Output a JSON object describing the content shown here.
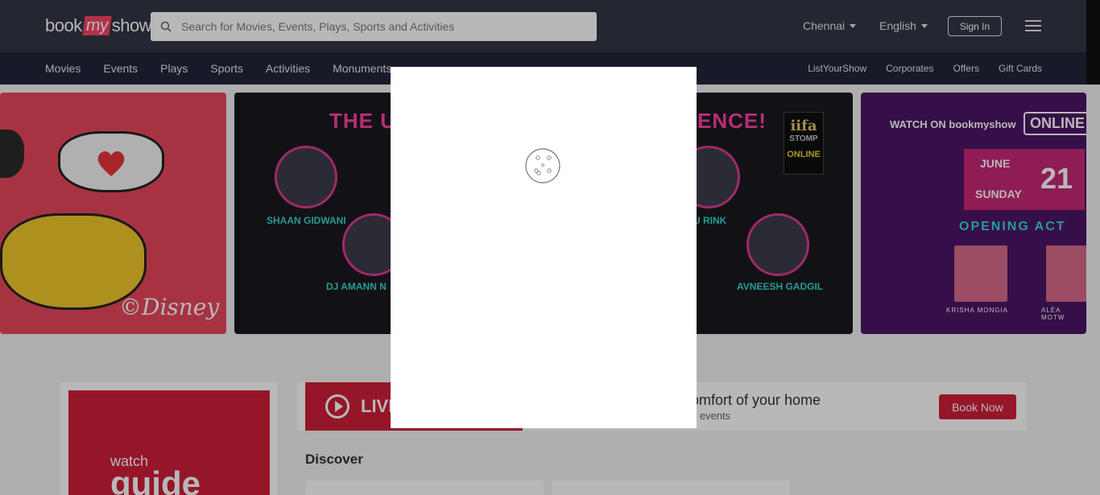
{
  "header": {
    "logo": {
      "book": "book",
      "my": "my",
      "show": "show"
    },
    "search": {
      "placeholder": "Search for Movies, Events, Plays, Sports and Activities"
    },
    "city": "Chennai",
    "language": "English",
    "sign_in": "Sign In"
  },
  "nav": {
    "left": [
      "Movies",
      "Events",
      "Plays",
      "Sports",
      "Activities",
      "Monuments"
    ],
    "right": [
      "ListYourShow",
      "Corporates",
      "Offers",
      "Gift Cards"
    ]
  },
  "banners": {
    "disney": {
      "text": "©Disney"
    },
    "iifa": {
      "title_left": "THE U",
      "title_right": "ENCE!",
      "logo_line1": "iifa",
      "logo_line2": "STOMP",
      "logo_line3": "ONLINE",
      "names": [
        "SHAAN GIDWANI",
        "DJ AMANN N",
        "U RINK",
        "AVNEESH GADGIL"
      ]
    },
    "watch_online": {
      "watch_on": "WATCH ON bookmyshow",
      "online": "ONLINE",
      "month": "JUNE",
      "day": "SUNDAY",
      "date": "21",
      "opening": "OPENING ACT",
      "names": [
        "KRISHA MONGIA",
        "ALÈA MOTW"
      ]
    }
  },
  "lower": {
    "watch_guide": {
      "watch": "watch",
      "guide": "guide"
    },
    "live_label": "LIVE",
    "comfort_title": "omfort of your home",
    "comfort_sub": "g events",
    "book_now": "Book Now",
    "discover": "Discover"
  },
  "colors": {
    "header_bg": "#333545",
    "nav_bg": "#222539",
    "brand_red": "#d01f3a",
    "brand_pink": "#f84464"
  },
  "modal": {
    "state": "loading"
  }
}
